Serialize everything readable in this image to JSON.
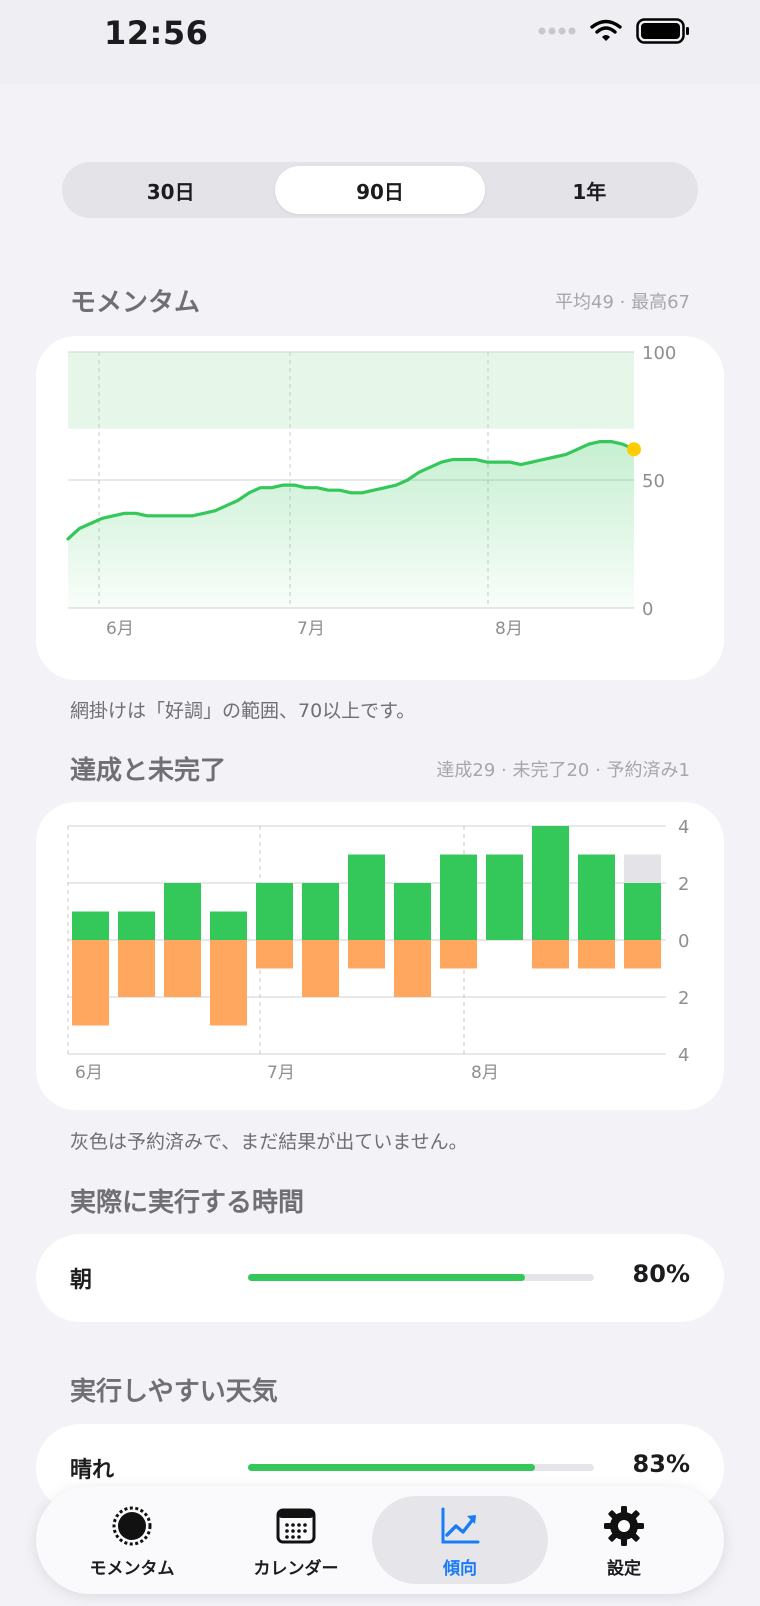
{
  "status_bar": {
    "time": "12:56"
  },
  "segmented": {
    "items": [
      "30日",
      "90日",
      "1年"
    ],
    "selected": "90日"
  },
  "momentum": {
    "title": "モメンタム",
    "meta": "平均49 · 最高67",
    "note": "網掛けは「好調」の範囲、70以上です。"
  },
  "completion": {
    "title": "達成と未完了",
    "meta": "達成29 · 未完了20 · 予約済み1",
    "note": "灰色は予約済みで、まだ結果が出ていません。"
  },
  "time_of_day": {
    "title": "実際に実行する時間",
    "rows": [
      {
        "label": "朝",
        "value": "80%",
        "fraction": 0.8
      }
    ]
  },
  "weather": {
    "title": "実行しやすい天気",
    "rows": [
      {
        "label": "晴れ",
        "value": "83%",
        "fraction": 0.83
      }
    ]
  },
  "tabbar": {
    "items": [
      {
        "label": "モメンタム",
        "icon": "momentum-ring-icon"
      },
      {
        "label": "カレンダー",
        "icon": "calendar-icon"
      },
      {
        "label": "傾向",
        "icon": "trend-chart-icon"
      },
      {
        "label": "設定",
        "icon": "gear-icon"
      }
    ],
    "selected": "傾向"
  },
  "colors": {
    "accent_green": "#34c759",
    "missed_orange": "#ffa75f",
    "scheduled_gray": "#e3e3e8",
    "current_point": "#ffcc00",
    "selected_tab_blue": "#1a7cf5"
  },
  "chart_data": [
    {
      "type": "line",
      "name": "momentum",
      "ylim": [
        0,
        100
      ],
      "yticks": [
        "0",
        "50",
        "100"
      ],
      "xticks": [
        "6月",
        "7月",
        "8月"
      ],
      "band": {
        "from": 70,
        "to": 100
      },
      "grid": true,
      "series": [
        {
          "values": [
            27,
            31,
            33,
            35,
            36,
            37,
            37,
            36,
            36,
            36,
            36,
            36,
            37,
            38,
            40,
            42,
            45,
            47,
            47,
            48,
            48,
            47,
            47,
            46,
            46,
            45,
            45,
            46,
            47,
            48,
            50,
            53,
            55,
            57,
            58,
            58,
            58,
            57,
            57,
            57,
            56,
            57,
            58,
            59,
            60,
            62,
            64,
            65,
            65,
            64,
            62
          ]
        }
      ]
    },
    {
      "type": "bar",
      "name": "completion",
      "xticks": [
        "6月",
        "7月",
        "8月"
      ],
      "ylim": [
        -4,
        4
      ],
      "yticks": [
        "4",
        "2",
        "0",
        "2",
        "4"
      ],
      "grid": true,
      "series": [
        {
          "name": "達成",
          "values": [
            1,
            1,
            2,
            1,
            2,
            2,
            3,
            2,
            3,
            3,
            4,
            3,
            2
          ]
        },
        {
          "name": "未完了",
          "values": [
            3,
            2,
            2,
            3,
            1,
            2,
            1,
            2,
            1,
            0,
            1,
            1,
            1
          ]
        },
        {
          "name": "予約済み",
          "values": [
            0,
            0,
            0,
            0,
            0,
            0,
            0,
            0,
            0,
            0,
            0,
            0,
            1
          ]
        }
      ]
    }
  ]
}
